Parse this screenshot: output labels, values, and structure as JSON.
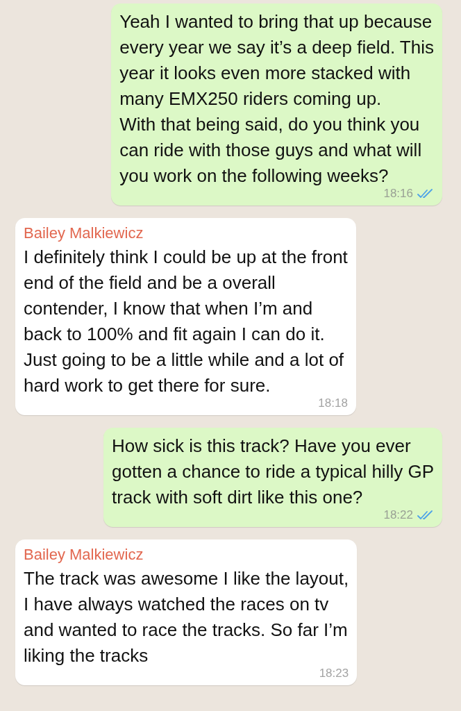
{
  "messages": [
    {
      "kind": "out",
      "text": "Yeah I wanted to bring that up because\nevery year we say it’s a deep field. This\nyear it looks even more stacked with\nmany EMX250 riders coming up.\nWith that being said, do you think you\ncan ride with those guys and what will\nyou work on the following weeks?",
      "time": "18:16",
      "read": true
    },
    {
      "kind": "in",
      "sender": "Bailey Malkiewicz",
      "text": "I definitely think I could be up at the front\nend of the field and be a overall\ncontender, I know that when I’m and\nback to 100% and fit again I can do it.\nJust going to be a little while and a lot of\nhard work to get there for sure.",
      "time": "18:18"
    },
    {
      "kind": "out",
      "text": "How sick is this track? Have you ever\ngotten a chance to ride a typical hilly GP\ntrack with soft dirt like this one?",
      "time": "18:22",
      "read": true
    },
    {
      "kind": "in",
      "sender": "Bailey Malkiewicz",
      "text": "The track was awesome I like the layout,\nI have always watched the races on tv\nand wanted to race the tracks. So far I’m\nliking the tracks",
      "time": "18:23"
    }
  ]
}
